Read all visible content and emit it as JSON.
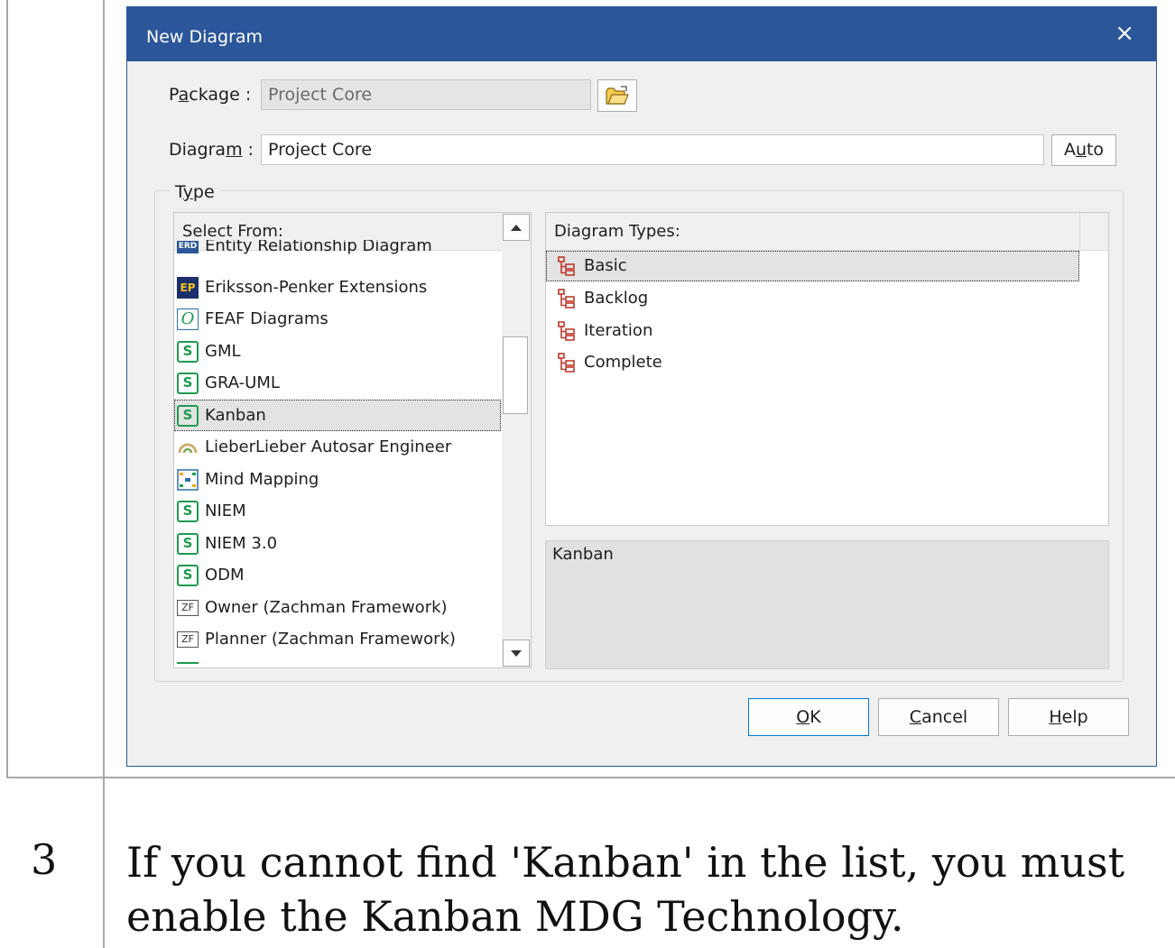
{
  "dialog": {
    "title": "New Diagram",
    "close_glyph": "×"
  },
  "package": {
    "label_pre": "P",
    "label_ul": "a",
    "label_post": "ckage :",
    "value": "Project Core"
  },
  "diagram": {
    "label_pre": "Diagra",
    "label_ul": "m",
    "label_post": " :",
    "value": "Project Core",
    "auto_pre": "A",
    "auto_ul": "u",
    "auto_post": "to"
  },
  "type_group": {
    "label_pre": "T",
    "label_ul": "y",
    "label_post": "pe"
  },
  "select_from": {
    "header": "Select From:",
    "items": [
      {
        "label": "Entity Relationship Diagram",
        "icon": "erd-icon"
      },
      {
        "label": "Eriksson-Penker Extensions",
        "icon": "ep-icon"
      },
      {
        "label": "FEAF Diagrams",
        "icon": "feaf-icon"
      },
      {
        "label": "GML",
        "icon": "mdg-icon"
      },
      {
        "label": "GRA-UML",
        "icon": "mdg-icon"
      },
      {
        "label": "Kanban",
        "icon": "mdg-icon",
        "selected": true
      },
      {
        "label": "LieberLieber Autosar Engineer",
        "icon": "lieberlieber-icon"
      },
      {
        "label": "Mind Mapping",
        "icon": "mind-map-icon"
      },
      {
        "label": "NIEM",
        "icon": "mdg-icon"
      },
      {
        "label": "NIEM 3.0",
        "icon": "mdg-icon"
      },
      {
        "label": "ODM",
        "icon": "mdg-icon"
      },
      {
        "label": "Owner (Zachman Framework)",
        "icon": "zf-icon"
      },
      {
        "label": "Planner (Zachman Framework)",
        "icon": "zf-icon"
      }
    ]
  },
  "diagram_types": {
    "header": "Diagram Types:",
    "items": [
      {
        "label": "Basic",
        "selected": true
      },
      {
        "label": "Backlog"
      },
      {
        "label": "Iteration"
      },
      {
        "label": "Complete"
      }
    ]
  },
  "description": "Kanban",
  "buttons": {
    "ok_ul": "O",
    "ok_post": "K",
    "cancel_ul": "C",
    "cancel_post": "ancel",
    "help_ul": "H",
    "help_post": "elp"
  },
  "step": {
    "number": "3",
    "text": "If you cannot find 'Kanban' in the list, you must enable the Kanban MDG Technology."
  },
  "colors": {
    "title_bar": "#2b579a",
    "mdg_icon": "#1f9a4e",
    "diagram_type_icon": "#c0392b"
  }
}
